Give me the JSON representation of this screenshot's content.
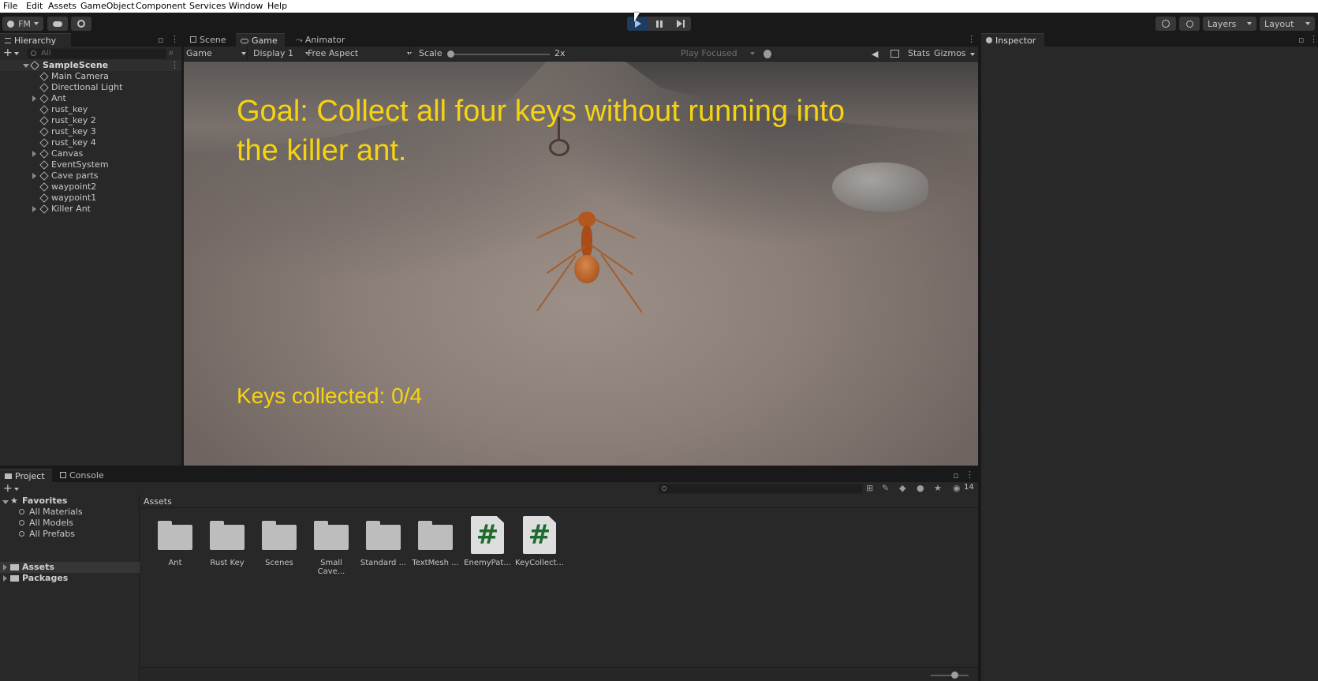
{
  "menu": [
    "File",
    "Edit",
    "Assets",
    "GameObject",
    "Component",
    "Services",
    "Window",
    "Help"
  ],
  "toolbar": {
    "account": "FM",
    "layers": "Layers",
    "layout": "Layout"
  },
  "hierarchy": {
    "tab": "Hierarchy",
    "search_placeholder": "All",
    "scene": "SampleScene",
    "items": [
      {
        "label": "Main Camera",
        "expandable": false
      },
      {
        "label": "Directional Light",
        "expandable": false
      },
      {
        "label": "Ant",
        "expandable": true
      },
      {
        "label": "rust_key",
        "expandable": false
      },
      {
        "label": "rust_key 2",
        "expandable": false
      },
      {
        "label": "rust_key 3",
        "expandable": false
      },
      {
        "label": "rust_key 4",
        "expandable": false
      },
      {
        "label": "Canvas",
        "expandable": true
      },
      {
        "label": "EventSystem",
        "expandable": false
      },
      {
        "label": "Cave parts",
        "expandable": true
      },
      {
        "label": "waypoint2",
        "expandable": false
      },
      {
        "label": "waypoint1",
        "expandable": false
      },
      {
        "label": "Killer Ant",
        "expandable": true
      }
    ]
  },
  "center_tabs": [
    "Scene",
    "Game",
    "Animator"
  ],
  "game_toolbar": {
    "view": "Game",
    "display": "Display 1",
    "aspect": "Free Aspect",
    "scale_label": "Scale",
    "scale_value": "2x",
    "play_mode": "Play Focused",
    "stats": "Stats",
    "gizmos": "Gizmos"
  },
  "game_hud": {
    "goal": "Goal: Collect all four keys without running into the killer ant.",
    "keys": "Keys collected: 0/4"
  },
  "inspector": {
    "tab": "Inspector"
  },
  "bottom_tabs": [
    "Project",
    "Console"
  ],
  "project": {
    "count": "14",
    "favorites_label": "Favorites",
    "favorites": [
      "All Materials",
      "All Models",
      "All Prefabs"
    ],
    "roots": [
      "Assets",
      "Packages"
    ],
    "breadcrumb": "Assets",
    "assets": [
      {
        "label": "Ant",
        "kind": "folder"
      },
      {
        "label": "Rust Key",
        "kind": "folder"
      },
      {
        "label": "Scenes",
        "kind": "folder"
      },
      {
        "label": "Small Cave...",
        "kind": "folder"
      },
      {
        "label": "Standard ...",
        "kind": "folder"
      },
      {
        "label": "TextMesh ...",
        "kind": "folder"
      },
      {
        "label": "EnemyPat...",
        "kind": "script"
      },
      {
        "label": "KeyCollect...",
        "kind": "script"
      }
    ]
  },
  "colors": {
    "hud_text": "#f6d312",
    "play_active": "#1e3c5e",
    "script_hash": "#1f6b2e"
  }
}
